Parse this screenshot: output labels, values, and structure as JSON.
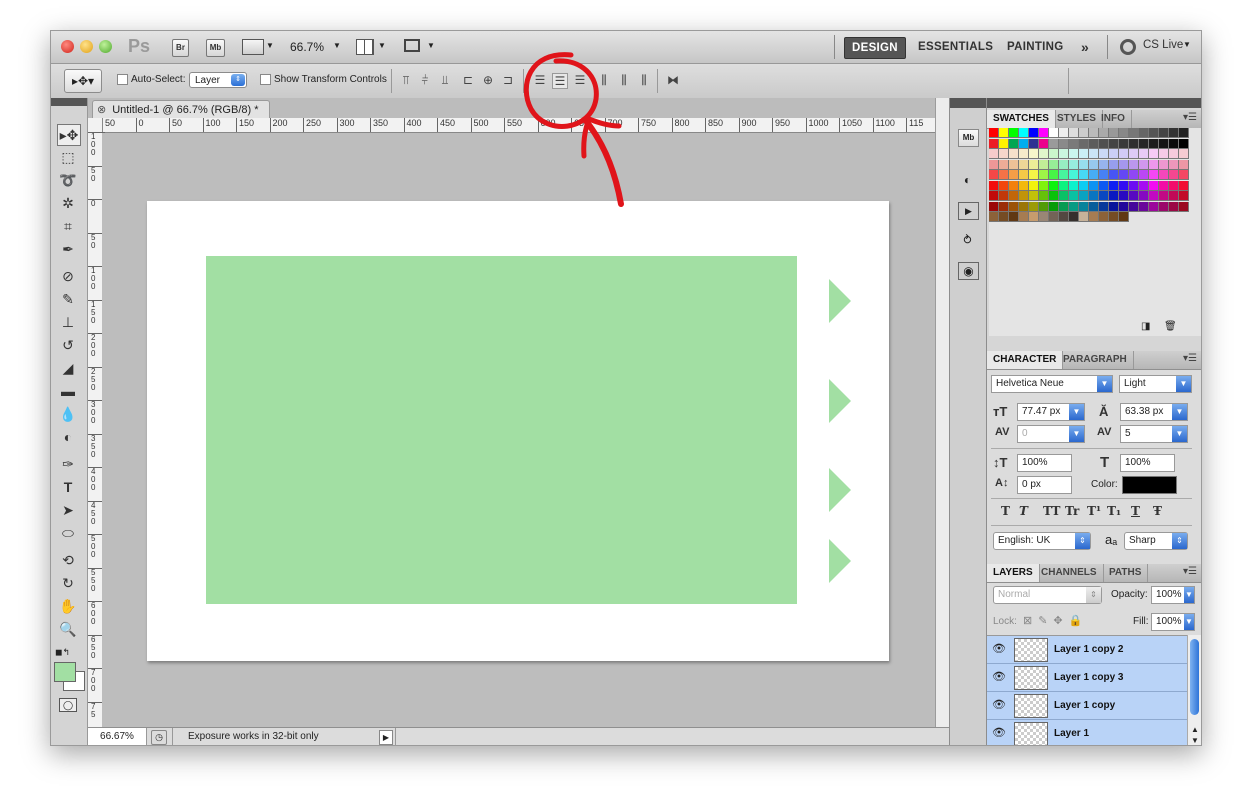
{
  "app": {
    "logo": "Ps",
    "bridge": "Br",
    "mini_bridge": "Mb",
    "zoom": "66.7%"
  },
  "workspaces": {
    "design": "DESIGN",
    "essentials": "ESSENTIALS",
    "painting": "PAINTING",
    "more": "»",
    "cs_live": "CS Live"
  },
  "options": {
    "auto_select_label": "Auto-Select:",
    "auto_select_value": "Layer",
    "show_transform_label": "Show Transform Controls"
  },
  "document": {
    "tab_title": "Untitled-1 @ 66.7% (RGB/8) *"
  },
  "ruler": {
    "h_ticks": [
      "50",
      "0",
      "50",
      "100",
      "150",
      "200",
      "250",
      "300",
      "350",
      "400",
      "450",
      "500",
      "550",
      "600",
      "650",
      "700",
      "750",
      "800",
      "850",
      "900",
      "950",
      "1000",
      "1050",
      "1100",
      "115"
    ],
    "v_ticks": [
      "1\n0\n0",
      "5\n0",
      "0",
      "5\n0",
      "1\n0\n0",
      "1\n5\n0",
      "2\n0\n0",
      "2\n5\n0",
      "3\n0\n0",
      "3\n5\n0",
      "4\n0\n0",
      "4\n5\n0",
      "5\n0\n0",
      "5\n5\n0",
      "6\n0\n0",
      "6\n5\n0",
      "7\n0\n0",
      "7\n5"
    ]
  },
  "status": {
    "zoom": "66.67%",
    "info": "Exposure works in 32-bit only"
  },
  "swatches_panel": {
    "tabs": [
      "SWATCHES",
      "STYLES",
      "INFO"
    ]
  },
  "character_panel": {
    "tabs": [
      "CHARACTER",
      "PARAGRAPH"
    ],
    "font_family": "Helvetica Neue",
    "font_style": "Light",
    "font_size": "77.47 px",
    "leading": "63.38 px",
    "kerning": "0",
    "tracking": "5",
    "vertical_scale": "100%",
    "horizontal_scale": "100%",
    "baseline_shift": "0 px",
    "color_label": "Color:",
    "style_buttons": [
      "T",
      "T",
      "TT",
      "Tr",
      "T¹",
      "T₁",
      "T",
      "Ŧ"
    ],
    "language": "English: UK",
    "aa_label": "aₐ",
    "antialias": "Sharp"
  },
  "layers_panel": {
    "tabs": [
      "LAYERS",
      "CHANNELS",
      "PATHS"
    ],
    "blend_mode": "Normal",
    "opacity_label": "Opacity:",
    "opacity": "100%",
    "lock_label": "Lock:",
    "fill_label": "Fill:",
    "fill": "100%",
    "layers": [
      "Layer 1 copy 2",
      "Layer 1 copy 3",
      "Layer 1 copy",
      "Layer 1"
    ]
  },
  "colors": {
    "green": "#a2dfa3",
    "annotation": "#e0141a",
    "selected_layer": "#b9d3f7"
  }
}
